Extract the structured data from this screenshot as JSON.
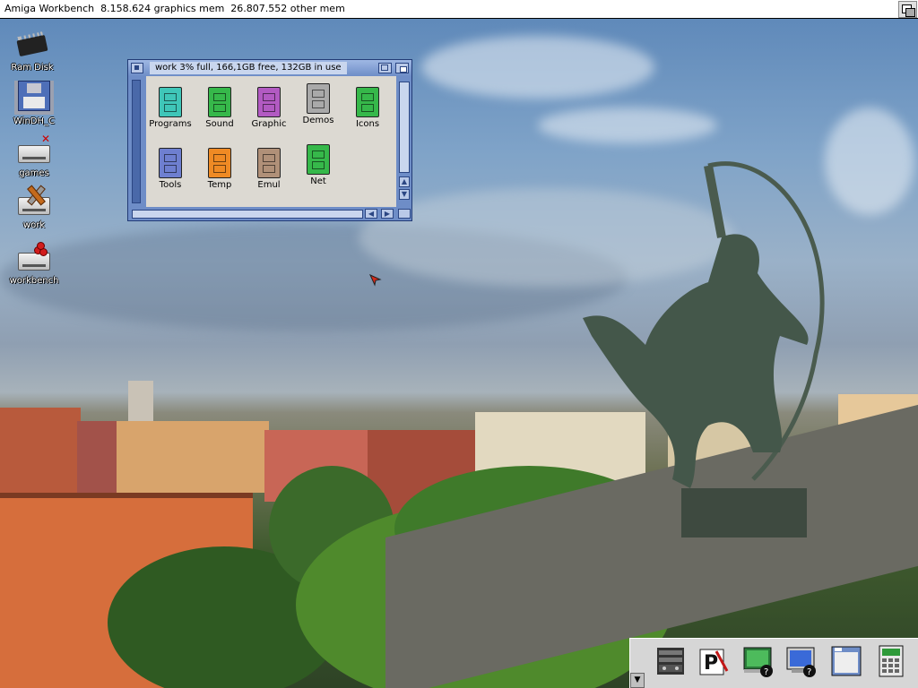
{
  "screen": {
    "title": "Amiga Workbench  8.158.624 graphics mem  26.807.552 other mem"
  },
  "desktop_icons": [
    {
      "label": "Ram Disk",
      "icon": "ram-chip-icon"
    },
    {
      "label": "WinDH_C",
      "icon": "floppy-disk-icon"
    },
    {
      "label": "games",
      "icon": "hard-drive-icon"
    },
    {
      "label": "work",
      "icon": "hard-drive-tools-icon"
    },
    {
      "label": "workbench",
      "icon": "hard-drive-cherry-icon"
    }
  ],
  "drawer": {
    "title": "work  3% full, 166,1GB free, 132GB in use",
    "items": [
      {
        "label": "Programs",
        "color": "#3fc6b8"
      },
      {
        "label": "Sound",
        "color": "#36b84a"
      },
      {
        "label": "Graphic",
        "color": "#b25ac2"
      },
      {
        "label": "Demos",
        "color": "#a9a9a9"
      },
      {
        "label": "Icons",
        "color": "#36b84a"
      },
      {
        "label": "Tools",
        "color": "#6e7fd0"
      },
      {
        "label": "Temp",
        "color": "#ef8a24"
      },
      {
        "label": "Emul",
        "color": "#b09078"
      },
      {
        "label": "Net",
        "color": "#36b84a"
      }
    ]
  },
  "dock": {
    "items": [
      {
        "icon": "stereo-rack-icon"
      },
      {
        "icon": "paint-program-icon"
      },
      {
        "icon": "screen-mode-help-icon"
      },
      {
        "icon": "monitor-help-icon"
      },
      {
        "icon": "window-prefs-icon"
      },
      {
        "icon": "calculator-icon"
      }
    ]
  },
  "colors": {
    "window_frame": "#6e8dc7",
    "window_content": "#dcd9d2",
    "screen_bar": "#ffffff"
  }
}
